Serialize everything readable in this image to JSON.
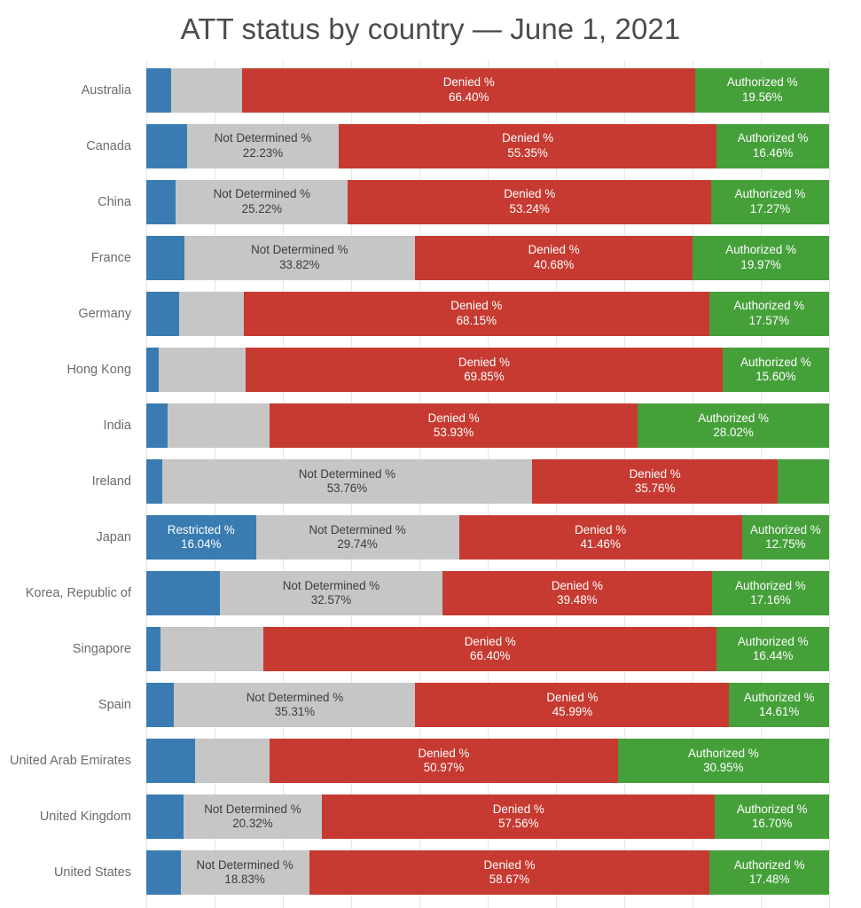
{
  "chart_data": {
    "type": "bar",
    "subtype": "horizontal-stacked-100",
    "title": "ATT status by country — June 1, 2021",
    "xlabel": "",
    "ylabel": "",
    "xlim": [
      0,
      100
    ],
    "grid": true,
    "grid_step": 10,
    "legend": "none",
    "value_suffix": "%",
    "categories": [
      "Australia",
      "Canada",
      "China",
      "France",
      "Germany",
      "Hong Kong",
      "India",
      "Ireland",
      "Japan",
      "Korea, Republic of",
      "Singapore",
      "Spain",
      "United Arab Emirates",
      "United Kingdom",
      "United States"
    ],
    "series": [
      {
        "name": "Restricted %",
        "color": "#3a7cb1",
        "values": [
          3.64,
          5.96,
          4.33,
          5.53,
          4.75,
          1.8,
          3.1,
          2.3,
          16.04,
          10.79,
          2.05,
          4.09,
          7.08,
          5.42,
          5.02
        ]
      },
      {
        "name": "Not Determined %",
        "color": "#c6c6c6",
        "values": [
          10.4,
          22.23,
          25.22,
          33.82,
          9.53,
          12.75,
          14.95,
          53.76,
          29.74,
          32.57,
          15.11,
          35.31,
          11.0,
          20.32,
          18.83
        ]
      },
      {
        "name": "Denied %",
        "color": "#c63a31",
        "values": [
          66.4,
          55.35,
          53.24,
          40.68,
          68.15,
          69.85,
          53.93,
          35.76,
          41.46,
          39.48,
          66.4,
          45.99,
          50.97,
          57.56,
          58.67
        ]
      },
      {
        "name": "Authorized %",
        "color": "#45a03a",
        "values": [
          19.56,
          16.46,
          17.27,
          19.97,
          17.57,
          15.6,
          28.02,
          7.42,
          12.75,
          17.16,
          16.44,
          14.61,
          30.95,
          16.7,
          17.48
        ]
      }
    ],
    "rows": [
      {
        "category": "Australia",
        "segments": [
          {
            "name": "Restricted %",
            "value": 3.64,
            "value_label": "",
            "show_label": false,
            "kind": "restricted"
          },
          {
            "name": "Not Determined %",
            "value": 10.4,
            "value_label": "",
            "show_label": false,
            "kind": "notdetermined"
          },
          {
            "name": "Denied %",
            "value": 66.4,
            "value_label": "66.40%",
            "show_label": true,
            "kind": "denied"
          },
          {
            "name": "Authorized %",
            "value": 19.56,
            "value_label": "19.56%",
            "show_label": true,
            "kind": "authorized"
          }
        ]
      },
      {
        "category": "Canada",
        "segments": [
          {
            "name": "Restricted %",
            "value": 5.96,
            "value_label": "",
            "show_label": false,
            "kind": "restricted"
          },
          {
            "name": "Not Determined %",
            "value": 22.23,
            "value_label": "22.23%",
            "show_label": true,
            "kind": "notdetermined"
          },
          {
            "name": "Denied %",
            "value": 55.35,
            "value_label": "55.35%",
            "show_label": true,
            "kind": "denied"
          },
          {
            "name": "Authorized %",
            "value": 16.46,
            "value_label": "16.46%",
            "show_label": true,
            "kind": "authorized"
          }
        ]
      },
      {
        "category": "China",
        "segments": [
          {
            "name": "Restricted %",
            "value": 4.33,
            "value_label": "",
            "show_label": false,
            "kind": "restricted"
          },
          {
            "name": "Not Determined %",
            "value": 25.22,
            "value_label": "25.22%",
            "show_label": true,
            "kind": "notdetermined"
          },
          {
            "name": "Denied %",
            "value": 53.24,
            "value_label": "53.24%",
            "show_label": true,
            "kind": "denied"
          },
          {
            "name": "Authorized %",
            "value": 17.27,
            "value_label": "17.27%",
            "show_label": true,
            "kind": "authorized"
          }
        ]
      },
      {
        "category": "France",
        "segments": [
          {
            "name": "Restricted %",
            "value": 5.53,
            "value_label": "",
            "show_label": false,
            "kind": "restricted"
          },
          {
            "name": "Not Determined %",
            "value": 33.82,
            "value_label": "33.82%",
            "show_label": true,
            "kind": "notdetermined"
          },
          {
            "name": "Denied %",
            "value": 40.68,
            "value_label": "40.68%",
            "show_label": true,
            "kind": "denied"
          },
          {
            "name": "Authorized %",
            "value": 19.97,
            "value_label": "19.97%",
            "show_label": true,
            "kind": "authorized"
          }
        ]
      },
      {
        "category": "Germany",
        "segments": [
          {
            "name": "Restricted %",
            "value": 4.75,
            "value_label": "",
            "show_label": false,
            "kind": "restricted"
          },
          {
            "name": "Not Determined %",
            "value": 9.53,
            "value_label": "",
            "show_label": false,
            "kind": "notdetermined"
          },
          {
            "name": "Denied %",
            "value": 68.15,
            "value_label": "68.15%",
            "show_label": true,
            "kind": "denied"
          },
          {
            "name": "Authorized %",
            "value": 17.57,
            "value_label": "17.57%",
            "show_label": true,
            "kind": "authorized"
          }
        ]
      },
      {
        "category": "Hong Kong",
        "segments": [
          {
            "name": "Restricted %",
            "value": 1.8,
            "value_label": "",
            "show_label": false,
            "kind": "restricted"
          },
          {
            "name": "Not Determined %",
            "value": 12.75,
            "value_label": "",
            "show_label": false,
            "kind": "notdetermined"
          },
          {
            "name": "Denied %",
            "value": 69.85,
            "value_label": "69.85%",
            "show_label": true,
            "kind": "denied"
          },
          {
            "name": "Authorized %",
            "value": 15.6,
            "value_label": "15.60%",
            "show_label": true,
            "kind": "authorized"
          }
        ]
      },
      {
        "category": "India",
        "segments": [
          {
            "name": "Restricted %",
            "value": 3.1,
            "value_label": "",
            "show_label": false,
            "kind": "restricted"
          },
          {
            "name": "Not Determined %",
            "value": 14.95,
            "value_label": "",
            "show_label": false,
            "kind": "notdetermined"
          },
          {
            "name": "Denied %",
            "value": 53.93,
            "value_label": "53.93%",
            "show_label": true,
            "kind": "denied"
          },
          {
            "name": "Authorized %",
            "value": 28.02,
            "value_label": "28.02%",
            "show_label": true,
            "kind": "authorized"
          }
        ]
      },
      {
        "category": "Ireland",
        "segments": [
          {
            "name": "Restricted %",
            "value": 2.3,
            "value_label": "",
            "show_label": false,
            "kind": "restricted"
          },
          {
            "name": "Not Determined %",
            "value": 53.76,
            "value_label": "53.76%",
            "show_label": true,
            "kind": "notdetermined"
          },
          {
            "name": "Denied %",
            "value": 35.76,
            "value_label": "35.76%",
            "show_label": true,
            "kind": "denied"
          },
          {
            "name": "Authorized %",
            "value": 7.42,
            "value_label": "",
            "show_label": false,
            "kind": "authorized"
          }
        ]
      },
      {
        "category": "Japan",
        "segments": [
          {
            "name": "Restricted %",
            "value": 16.04,
            "value_label": "16.04%",
            "show_label": true,
            "kind": "restricted"
          },
          {
            "name": "Not Determined %",
            "value": 29.74,
            "value_label": "29.74%",
            "show_label": true,
            "kind": "notdetermined"
          },
          {
            "name": "Denied %",
            "value": 41.46,
            "value_label": "41.46%",
            "show_label": true,
            "kind": "denied"
          },
          {
            "name": "Authorized %",
            "value": 12.75,
            "value_label": "12.75%",
            "show_label": true,
            "kind": "authorized"
          }
        ]
      },
      {
        "category": "Korea, Republic of",
        "segments": [
          {
            "name": "Restricted %",
            "value": 10.79,
            "value_label": "",
            "show_label": false,
            "kind": "restricted"
          },
          {
            "name": "Not Determined %",
            "value": 32.57,
            "value_label": "32.57%",
            "show_label": true,
            "kind": "notdetermined"
          },
          {
            "name": "Denied %",
            "value": 39.48,
            "value_label": "39.48%",
            "show_label": true,
            "kind": "denied"
          },
          {
            "name": "Authorized %",
            "value": 17.16,
            "value_label": "17.16%",
            "show_label": true,
            "kind": "authorized"
          }
        ]
      },
      {
        "category": "Singapore",
        "segments": [
          {
            "name": "Restricted %",
            "value": 2.05,
            "value_label": "",
            "show_label": false,
            "kind": "restricted"
          },
          {
            "name": "Not Determined %",
            "value": 15.11,
            "value_label": "",
            "show_label": false,
            "kind": "notdetermined"
          },
          {
            "name": "Denied %",
            "value": 66.4,
            "value_label": "66.40%",
            "show_label": true,
            "kind": "denied"
          },
          {
            "name": "Authorized %",
            "value": 16.44,
            "value_label": "16.44%",
            "show_label": true,
            "kind": "authorized"
          }
        ]
      },
      {
        "category": "Spain",
        "segments": [
          {
            "name": "Restricted %",
            "value": 4.09,
            "value_label": "",
            "show_label": false,
            "kind": "restricted"
          },
          {
            "name": "Not Determined %",
            "value": 35.31,
            "value_label": "35.31%",
            "show_label": true,
            "kind": "notdetermined"
          },
          {
            "name": "Denied %",
            "value": 45.99,
            "value_label": "45.99%",
            "show_label": true,
            "kind": "denied"
          },
          {
            "name": "Authorized %",
            "value": 14.61,
            "value_label": "14.61%",
            "show_label": true,
            "kind": "authorized"
          }
        ]
      },
      {
        "category": "United Arab Emirates",
        "segments": [
          {
            "name": "Restricted %",
            "value": 7.08,
            "value_label": "",
            "show_label": false,
            "kind": "restricted"
          },
          {
            "name": "Not Determined %",
            "value": 11.0,
            "value_label": "",
            "show_label": false,
            "kind": "notdetermined"
          },
          {
            "name": "Denied %",
            "value": 50.97,
            "value_label": "50.97%",
            "show_label": true,
            "kind": "denied"
          },
          {
            "name": "Authorized %",
            "value": 30.95,
            "value_label": "30.95%",
            "show_label": true,
            "kind": "authorized"
          }
        ]
      },
      {
        "category": "United Kingdom",
        "segments": [
          {
            "name": "Restricted %",
            "value": 5.42,
            "value_label": "",
            "show_label": false,
            "kind": "restricted"
          },
          {
            "name": "Not Determined %",
            "value": 20.32,
            "value_label": "20.32%",
            "show_label": true,
            "kind": "notdetermined"
          },
          {
            "name": "Denied %",
            "value": 57.56,
            "value_label": "57.56%",
            "show_label": true,
            "kind": "denied"
          },
          {
            "name": "Authorized %",
            "value": 16.7,
            "value_label": "16.70%",
            "show_label": true,
            "kind": "authorized"
          }
        ]
      },
      {
        "category": "United States",
        "segments": [
          {
            "name": "Restricted %",
            "value": 5.02,
            "value_label": "",
            "show_label": false,
            "kind": "restricted"
          },
          {
            "name": "Not Determined %",
            "value": 18.83,
            "value_label": "18.83%",
            "show_label": true,
            "kind": "notdetermined"
          },
          {
            "name": "Denied %",
            "value": 58.67,
            "value_label": "58.67%",
            "show_label": true,
            "kind": "denied"
          },
          {
            "name": "Authorized %",
            "value": 17.48,
            "value_label": "17.48%",
            "show_label": true,
            "kind": "authorized"
          }
        ]
      }
    ],
    "colors": {
      "restricted": "#3a7cb1",
      "not_determined": "#c6c6c6",
      "denied": "#c63a31",
      "authorized": "#45a03a",
      "gridline": "#e6e6e6",
      "title_text": "#4b4b4b",
      "axis_label_text": "#6b6b6b",
      "background": "#ffffff"
    }
  }
}
